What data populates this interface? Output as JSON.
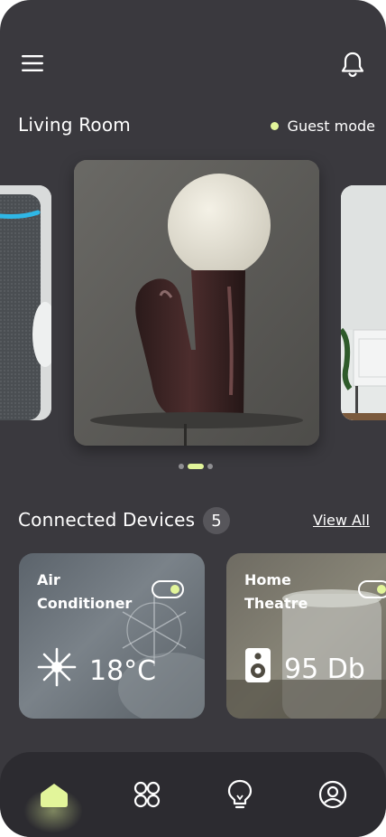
{
  "header": {
    "menu_icon": "hamburger-menu-icon",
    "notification_icon": "bell-icon"
  },
  "room": {
    "title": "Living Room",
    "guest_mode_label": "Guest mode",
    "guest_mode_dot_color": "#e2f59a",
    "carousel": {
      "slides": [
        {
          "label": "smart-speaker"
        },
        {
          "label": "table-lamp"
        },
        {
          "label": "tv-cabinet"
        }
      ],
      "active_index": 1,
      "dot_count": 3
    }
  },
  "devices": {
    "title": "Connected Devices",
    "count": "5",
    "view_all": "View All",
    "items": [
      {
        "name_line1": "Air",
        "name_line2": "Conditioner",
        "reading": "18°C",
        "icon": "snowflake-icon",
        "toggle_on": true
      },
      {
        "name_line1": "Home",
        "name_line2": "Theatre",
        "reading": "95 Db",
        "icon": "speaker-icon",
        "toggle_on": true
      }
    ]
  },
  "nav": {
    "items": [
      {
        "icon": "home-icon",
        "active": true
      },
      {
        "icon": "grid-icon",
        "active": false
      },
      {
        "icon": "lightbulb-icon",
        "active": false
      },
      {
        "icon": "profile-icon",
        "active": false
      }
    ],
    "accent": "#e2f59a"
  }
}
